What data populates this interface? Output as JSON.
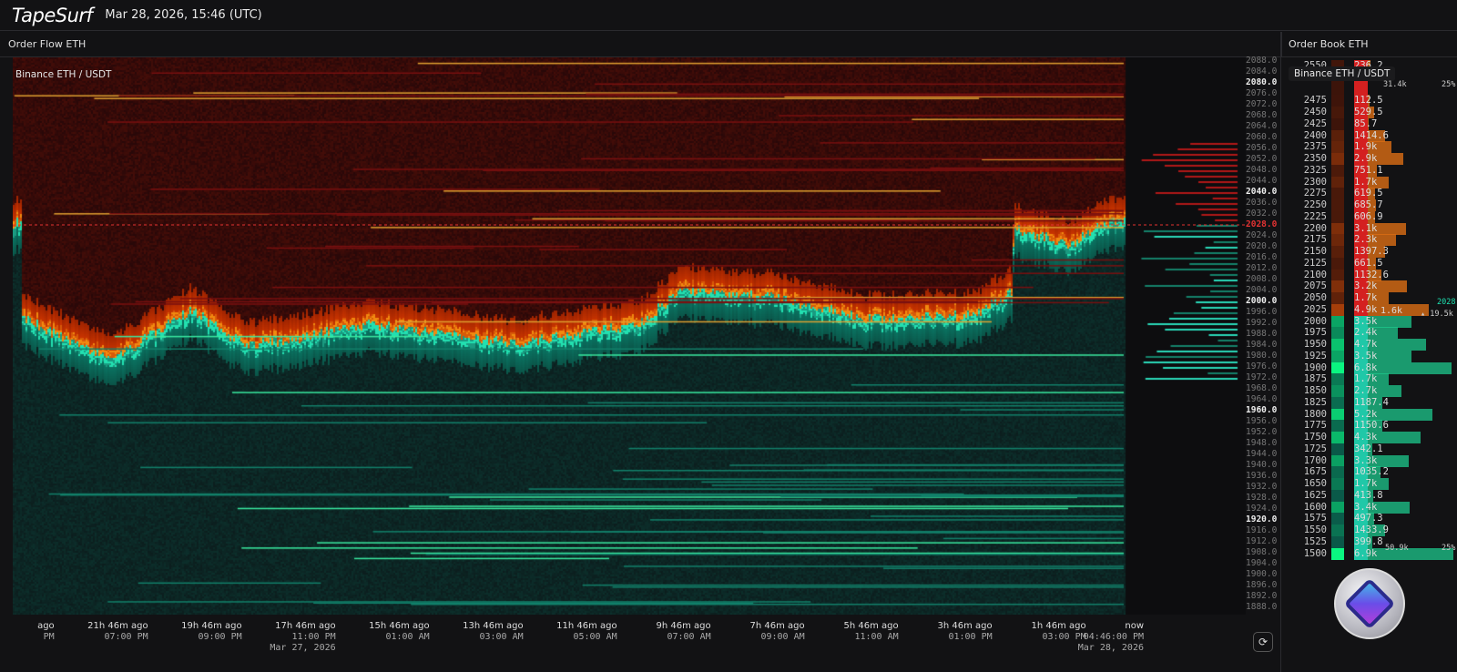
{
  "app": {
    "logo": "TapeSurf",
    "datetime": "Mar 28, 2026, 15:46 (UTC)"
  },
  "order_flow": {
    "title": "Order Flow ETH",
    "source": "Binance ETH / USDT",
    "reset_icon": "refresh-icon"
  },
  "order_book": {
    "title": "Order Book ETH",
    "source": "Binance ETH / USDT",
    "ask_total": "31.4k",
    "ask_pct": "25%",
    "bid_total": "50.9k",
    "bid_pct": "25%",
    "last_price": "2028",
    "mid_overlay": "1.6k",
    "cum_marker": "19.5k",
    "asks": [
      {
        "price": "2550",
        "size": "236.2"
      },
      {
        "price": "",
        "size": ""
      },
      {
        "price": "",
        "size": ""
      },
      {
        "price": "2475",
        "size": "112.5"
      },
      {
        "price": "2450",
        "size": "529.5"
      },
      {
        "price": "2425",
        "size": "85.7"
      },
      {
        "price": "2400",
        "size": "1414.6"
      },
      {
        "price": "2375",
        "size": "1.9k"
      },
      {
        "price": "2350",
        "size": "2.9k"
      },
      {
        "price": "2325",
        "size": "751.1"
      },
      {
        "price": "2300",
        "size": "1.7k"
      },
      {
        "price": "2275",
        "size": "619.5"
      },
      {
        "price": "2250",
        "size": "685.7"
      },
      {
        "price": "2225",
        "size": "606.9"
      },
      {
        "price": "2200",
        "size": "3.1k"
      },
      {
        "price": "2175",
        "size": "2.3k"
      },
      {
        "price": "2150",
        "size": "1397.3"
      },
      {
        "price": "2125",
        "size": "661.5"
      },
      {
        "price": "2100",
        "size": "1132.6"
      },
      {
        "price": "2075",
        "size": "3.2k"
      },
      {
        "price": "2050",
        "size": "1.7k"
      },
      {
        "price": "2025",
        "size": "4.9k"
      }
    ],
    "bids": [
      {
        "price": "2000",
        "size": "3.5k"
      },
      {
        "price": "1975",
        "size": "2.4k"
      },
      {
        "price": "1950",
        "size": "4.7k"
      },
      {
        "price": "1925",
        "size": "3.5k"
      },
      {
        "price": "1900",
        "size": "6.8k"
      },
      {
        "price": "1875",
        "size": "1.7k"
      },
      {
        "price": "1850",
        "size": "2.7k"
      },
      {
        "price": "1825",
        "size": "1187.4"
      },
      {
        "price": "1800",
        "size": "5.2k"
      },
      {
        "price": "1775",
        "size": "1150.6"
      },
      {
        "price": "1750",
        "size": "4.3k"
      },
      {
        "price": "1725",
        "size": "342.1"
      },
      {
        "price": "1700",
        "size": "3.3k"
      },
      {
        "price": "1675",
        "size": "1035.2"
      },
      {
        "price": "1650",
        "size": "1.7k"
      },
      {
        "price": "1625",
        "size": "413.8"
      },
      {
        "price": "1600",
        "size": "3.4k"
      },
      {
        "price": "1575",
        "size": "497.3"
      },
      {
        "price": "1550",
        "size": "1433.9"
      },
      {
        "price": "1525",
        "size": "399.8"
      },
      {
        "price": "1500",
        "size": "6.9k"
      }
    ]
  },
  "colors": {
    "bid": "#1de0b0",
    "ask": "#e02020",
    "resting_large": "#f0a020",
    "current_price": "#e23232"
  },
  "chart_data": {
    "type": "heatmap",
    "ylim": [
      1888,
      2088
    ],
    "y_ticks": [
      "2088.0",
      "2084.0",
      "2080.0",
      "2076.0",
      "2072.0",
      "2068.0",
      "2064.0",
      "2060.0",
      "2056.0",
      "2052.0",
      "2048.0",
      "2044.0",
      "2040.0",
      "2036.0",
      "2032.0",
      "2028.0",
      "2024.0",
      "2020.0",
      "2016.0",
      "2012.0",
      "2008.0",
      "2004.0",
      "2000.0",
      "1996.0",
      "1992.0",
      "1988.0",
      "1984.0",
      "1980.0",
      "1976.0",
      "1972.0",
      "1968.0",
      "1964.0",
      "1960.0",
      "1956.0",
      "1952.0",
      "1948.0",
      "1944.0",
      "1940.0",
      "1936.0",
      "1932.0",
      "1928.0",
      "1924.0",
      "1920.0",
      "1916.0",
      "1912.0",
      "1908.0",
      "1904.0",
      "1900.0",
      "1896.0",
      "1892.0",
      "1888.0"
    ],
    "current_price_label": "2028.0",
    "x_ticks": [
      {
        "hours_ago": 23,
        "rel": "ago",
        "time": "PM",
        "date": ""
      },
      {
        "hours_ago": 21,
        "rel": "21h 46m ago",
        "time": "07:00 PM",
        "date": ""
      },
      {
        "hours_ago": 19,
        "rel": "19h 46m ago",
        "time": "09:00 PM",
        "date": ""
      },
      {
        "hours_ago": 17,
        "rel": "17h 46m ago",
        "time": "11:00 PM",
        "date": "Mar 27, 2026"
      },
      {
        "hours_ago": 15,
        "rel": "15h 46m ago",
        "time": "01:00 AM",
        "date": ""
      },
      {
        "hours_ago": 13,
        "rel": "13h 46m ago",
        "time": "03:00 AM",
        "date": ""
      },
      {
        "hours_ago": 11,
        "rel": "11h 46m ago",
        "time": "05:00 AM",
        "date": ""
      },
      {
        "hours_ago": 9,
        "rel": "9h 46m ago",
        "time": "07:00 AM",
        "date": ""
      },
      {
        "hours_ago": 7,
        "rel": "7h 46m ago",
        "time": "09:00 AM",
        "date": ""
      },
      {
        "hours_ago": 5,
        "rel": "5h 46m ago",
        "time": "11:00 AM",
        "date": ""
      },
      {
        "hours_ago": 3,
        "rel": "3h 46m ago",
        "time": "01:00 PM",
        "date": ""
      },
      {
        "hours_ago": 1,
        "rel": "1h 46m ago",
        "time": "03:00 PM",
        "date": ""
      },
      {
        "hours_ago": -0.23,
        "rel": "now",
        "time": "04:46:00 PM",
        "date": "Mar 28, 2026"
      }
    ],
    "price_series_hours_ago": [
      23.2,
      21.3,
      19.6,
      18.4,
      15.7,
      12.7,
      10,
      9.2,
      7.3,
      5.2,
      2.9,
      2.1,
      2.05,
      0.8,
      0.2
    ],
    "price_series": [
      1994,
      1979,
      1997,
      1984,
      1992,
      1985,
      1992,
      2004,
      2002,
      1994,
      1995,
      2004,
      2027,
      2021,
      2029
    ]
  }
}
